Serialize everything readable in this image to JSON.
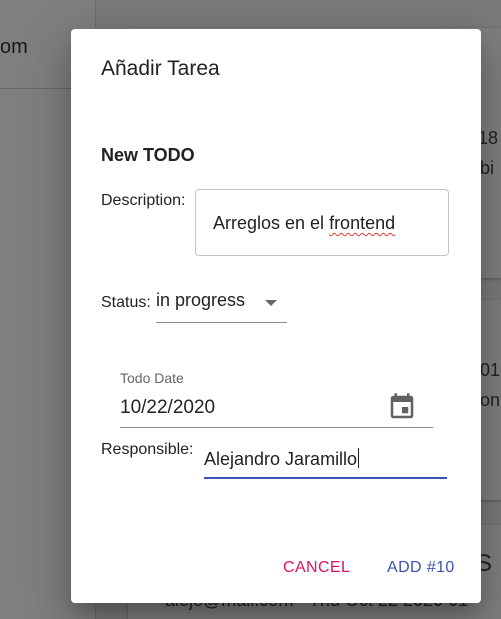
{
  "background": {
    "left_partial_text": "om",
    "fragments": [
      "18",
      "bi",
      "01",
      "on",
      "S",
      "alejo@mail.com · Thu Oct 22 2020 01"
    ]
  },
  "dialog": {
    "title": "Añadir Tarea",
    "form_heading": "New TODO",
    "description": {
      "label": "Description:",
      "value_prefix": "Arreglos en el ",
      "value_misspelled": "frontend"
    },
    "status": {
      "label": "Status:",
      "value": "in progress"
    },
    "todo_date": {
      "label": "Todo Date",
      "value": "10/22/2020"
    },
    "responsible": {
      "label": "Responsible:",
      "value": "Alejandro Jaramillo"
    },
    "actions": {
      "cancel": "CANCEL",
      "add": "ADD #10"
    }
  },
  "colors": {
    "primary": "#3f51b5",
    "secondary": "#e0115f",
    "overlay": "rgba(0,0,0,0.5)"
  },
  "icons": {
    "date_picker": "calendar-icon",
    "select": "chevron-down-icon"
  }
}
